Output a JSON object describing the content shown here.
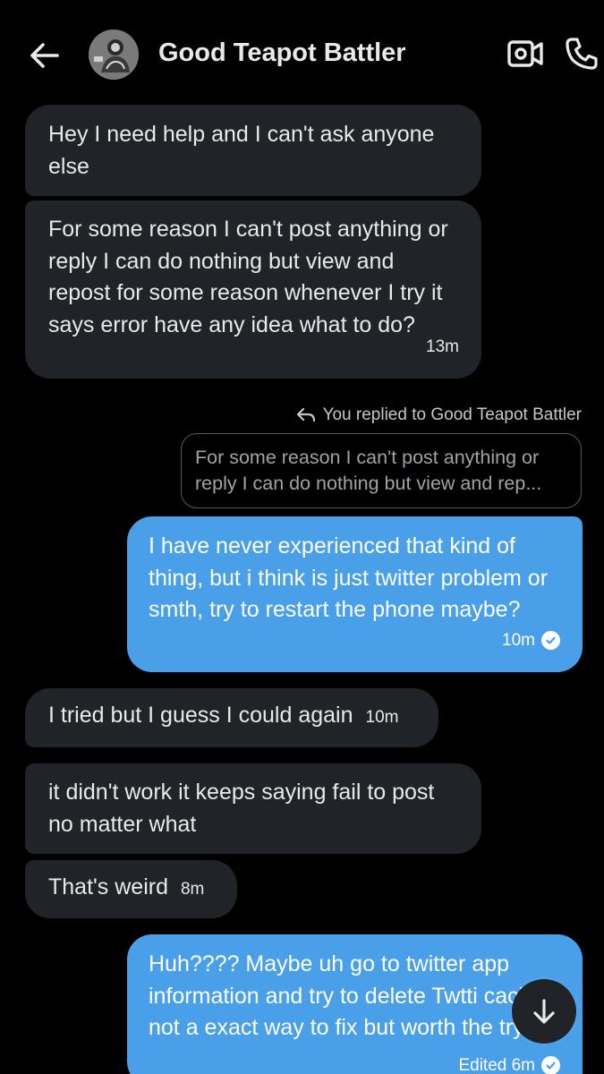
{
  "header": {
    "title": "Good Teapot Battler",
    "back_icon": "arrow-left-icon",
    "video_icon": "video-camera-icon",
    "call_icon": "phone-icon"
  },
  "messages": [
    {
      "direction": "incoming",
      "text": "Hey I need help and I can't ask anyone else"
    },
    {
      "direction": "incoming",
      "text": "For some reason I can't post anything or reply I can do nothing but view and repost for some reason whenever I try it says error have any idea what to do?",
      "time": "13m"
    },
    {
      "direction": "outgoing",
      "reply_label": "You replied to Good Teapot Battler",
      "quote": "For some reason I can't post anything or reply I can do nothing but view and rep...",
      "text": "I have never experienced that kind of thing, but i think is just twitter problem or smth, try to restart the phone maybe?",
      "time": "10m"
    },
    {
      "direction": "incoming",
      "text": "I tried but I guess I could again",
      "time": "10m"
    },
    {
      "direction": "incoming",
      "text": "it didn't work it keeps saying fail to post no matter what"
    },
    {
      "direction": "incoming",
      "text": "That's weird",
      "time": "8m"
    },
    {
      "direction": "outgoing",
      "text": "Huh???? Maybe uh go to twitter app information and try to delete Twtti cache, not a exact way to fix but worth the try.",
      "time": "Edited 6m"
    }
  ],
  "colors": {
    "background": "#000000",
    "incoming_bubble": "#202327",
    "outgoing_bubble": "#4a9fe9"
  }
}
